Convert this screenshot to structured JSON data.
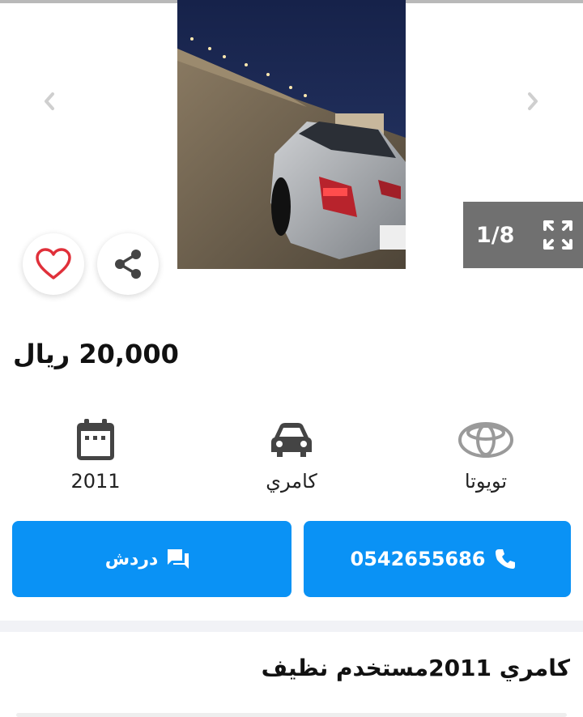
{
  "gallery": {
    "counter": "1/8",
    "photo_description_icon": "car-photo",
    "prev_icon": "chevron-left-icon",
    "next_icon": "chevron-right-icon",
    "expand_icon": "fullscreen-icon"
  },
  "actions": {
    "favorite_icon": "heart-icon",
    "share_icon": "share-icon"
  },
  "listing": {
    "price": "20,000 ريال",
    "title": "كامري 2011مستخدم نظيف"
  },
  "specs": {
    "year": "2011",
    "model": "كامري",
    "make": "تويوتا"
  },
  "buttons": {
    "chat_label": "دردش",
    "phone_label": "0542655686"
  },
  "colors": {
    "primary": "#0a92f5",
    "heart": "#e0303a",
    "counter_bg": "#6b6b6b"
  }
}
